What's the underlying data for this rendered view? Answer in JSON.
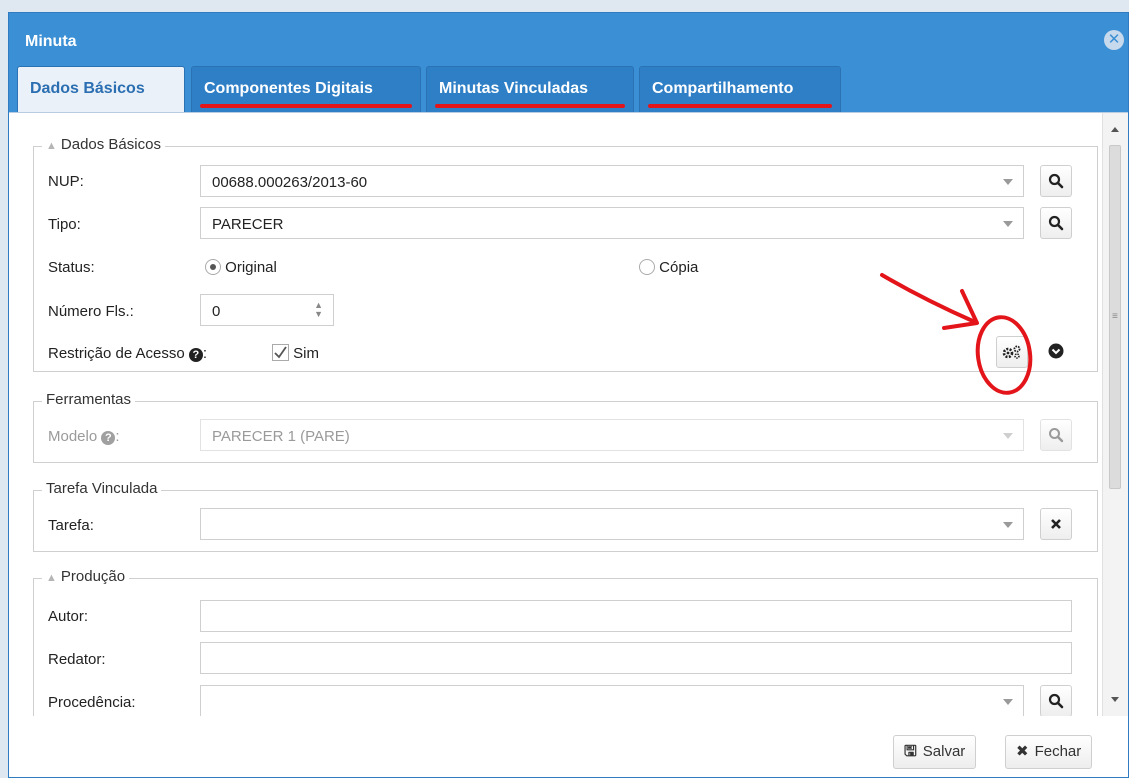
{
  "window": {
    "title": "Minuta"
  },
  "tabs": [
    {
      "label": "Dados Básicos",
      "active": true
    },
    {
      "label": "Componentes Digitais",
      "active": false
    },
    {
      "label": "Minutas Vinculadas",
      "active": false
    },
    {
      "label": "Compartilhamento",
      "active": false
    }
  ],
  "dados_basicos": {
    "legend": "Dados Básicos",
    "nup": {
      "label": "NUP:",
      "value": "00688.000263/2013-60"
    },
    "tipo": {
      "label": "Tipo:",
      "value": "PARECER"
    },
    "status": {
      "label": "Status:",
      "option_original": "Original",
      "option_copia": "Cópia",
      "selected": "Original"
    },
    "numero_fls": {
      "label": "Número Fls.:",
      "value": "0"
    },
    "restricao": {
      "label": "Restrição de Acesso",
      "suffix": ":",
      "checkbox_label": "Sim",
      "checked": true
    }
  },
  "ferramentas": {
    "legend": "Ferramentas",
    "modelo": {
      "label": "Modelo",
      "suffix": ":",
      "value": "PARECER 1 (PARE)"
    }
  },
  "tarefa_vinculada": {
    "legend": "Tarefa Vinculada",
    "tarefa": {
      "label": "Tarefa:",
      "value": ""
    }
  },
  "producao": {
    "legend": "Produção",
    "autor": {
      "label": "Autor:",
      "value": ""
    },
    "redator": {
      "label": "Redator:",
      "value": ""
    },
    "procedencia": {
      "label": "Procedência:",
      "value": ""
    }
  },
  "footer": {
    "save_label": "Salvar",
    "close_label": "Fechar"
  },
  "colors": {
    "window": "#3b8fd4",
    "annotation": "#e3151a"
  },
  "icons": [
    "close-icon",
    "search-icon",
    "gears-icon",
    "chevron-down-circle-icon",
    "save-icon",
    "x-icon",
    "help-icon"
  ]
}
